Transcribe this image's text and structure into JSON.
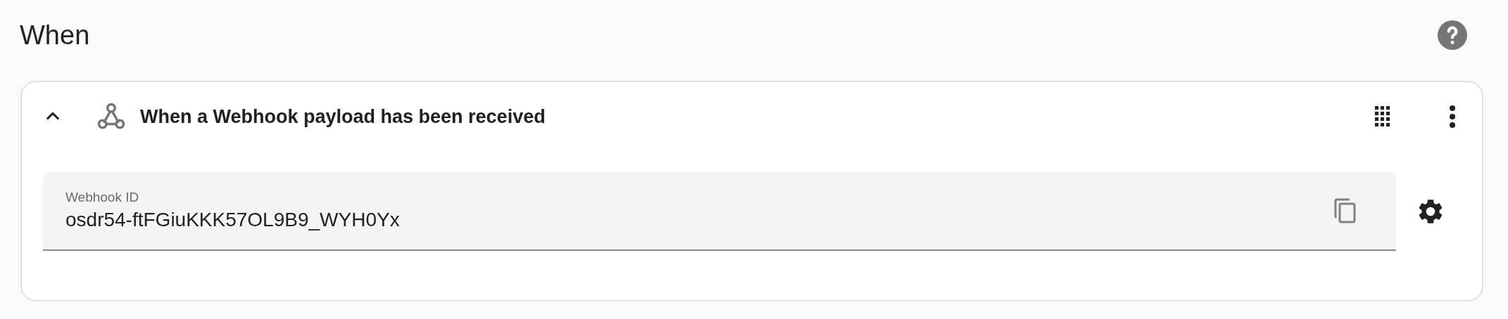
{
  "section": {
    "title": "When"
  },
  "trigger": {
    "title": "When a Webhook payload has been received",
    "expanded": true,
    "field": {
      "label": "Webhook ID",
      "value": "osdr54-ftFGiuKKK57OL9B9_WYH0Yx"
    }
  }
}
